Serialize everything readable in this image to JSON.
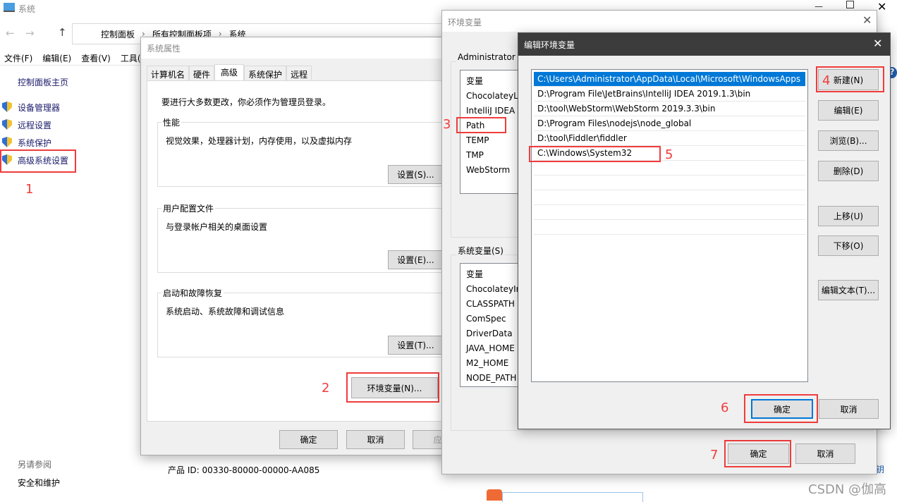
{
  "explorer": {
    "title": "系统",
    "breadcrumb": [
      "控制面板",
      "所有控制面板项",
      "系统"
    ],
    "menu": [
      "文件(F)",
      "编辑(E)",
      "查看(V)",
      "工具("
    ],
    "sidebar": {
      "home": "控制面板主页",
      "items": [
        "设备管理器",
        "远程设置",
        "系统保护",
        "高级系统设置"
      ],
      "see_also": "另请参阅",
      "security": "安全和维护"
    },
    "product_id": "产品 ID: 00330-80000-00000-AA085",
    "help": "?",
    "partial": "钥"
  },
  "sysprops": {
    "title": "系统属性",
    "tabs": [
      "计算机名",
      "硬件",
      "高级",
      "系统保护",
      "远程"
    ],
    "active_tab": "高级",
    "notice": "要进行大多数更改，你必须作为管理员登录。",
    "groups": [
      {
        "label": "性能",
        "desc": "视觉效果，处理器计划，内存使用，以及虚拟内存",
        "button": "设置(S)..."
      },
      {
        "label": "用户配置文件",
        "desc": "与登录帐户相关的桌面设置",
        "button": "设置(E)..."
      },
      {
        "label": "启动和故障恢复",
        "desc": "系统启动、系统故障和调试信息",
        "button": "设置(T)..."
      }
    ],
    "env_button": "环境变量(N)...",
    "ok": "确定",
    "cancel": "取消",
    "apply": "应用"
  },
  "envvars": {
    "title": "环境变量",
    "user_group": "Administrator 的用户变量(U)",
    "user_header": "变量",
    "user_vars": [
      "ChocolateyLa",
      "IntelliJ IDEA",
      "Path",
      "TEMP",
      "TMP",
      "WebStorm"
    ],
    "sys_group": "系统变量(S)",
    "sys_header": "变量",
    "sys_vars": [
      "ChocolateyIn",
      "CLASSPATH",
      "ComSpec",
      "DriverData",
      "JAVA_HOME",
      "M2_HOME",
      "NODE_PATH"
    ],
    "ok": "确定",
    "cancel": "取消"
  },
  "editenv": {
    "title": "编辑环境变量",
    "entries": [
      "C:\\Users\\Administrator\\AppData\\Local\\Microsoft\\WindowsApps",
      "D:\\Program File\\JetBrains\\IntelliJ IDEA 2019.1.3\\bin",
      "D:\\tool\\WebStorm\\WebStorm 2019.3.3\\bin",
      "D:\\Program Files\\nodejs\\node_global",
      "D:\\tool\\Fiddler\\fiddler",
      "C:\\Windows\\System32"
    ],
    "selected_index": 0,
    "buttons": [
      "新建(N)",
      "编辑(E)",
      "浏览(B)...",
      "删除(D)",
      "上移(U)",
      "下移(O)",
      "编辑文本(T)..."
    ],
    "ok": "确定",
    "cancel": "取消"
  },
  "annotations": [
    "1",
    "2",
    "3",
    "4",
    "5",
    "6",
    "7"
  ],
  "watermark": "CSDN @伽高",
  "colors": {
    "annotation": "#f03c3c",
    "selection": "#0078d7",
    "title_dark": "#3c3c3c"
  }
}
